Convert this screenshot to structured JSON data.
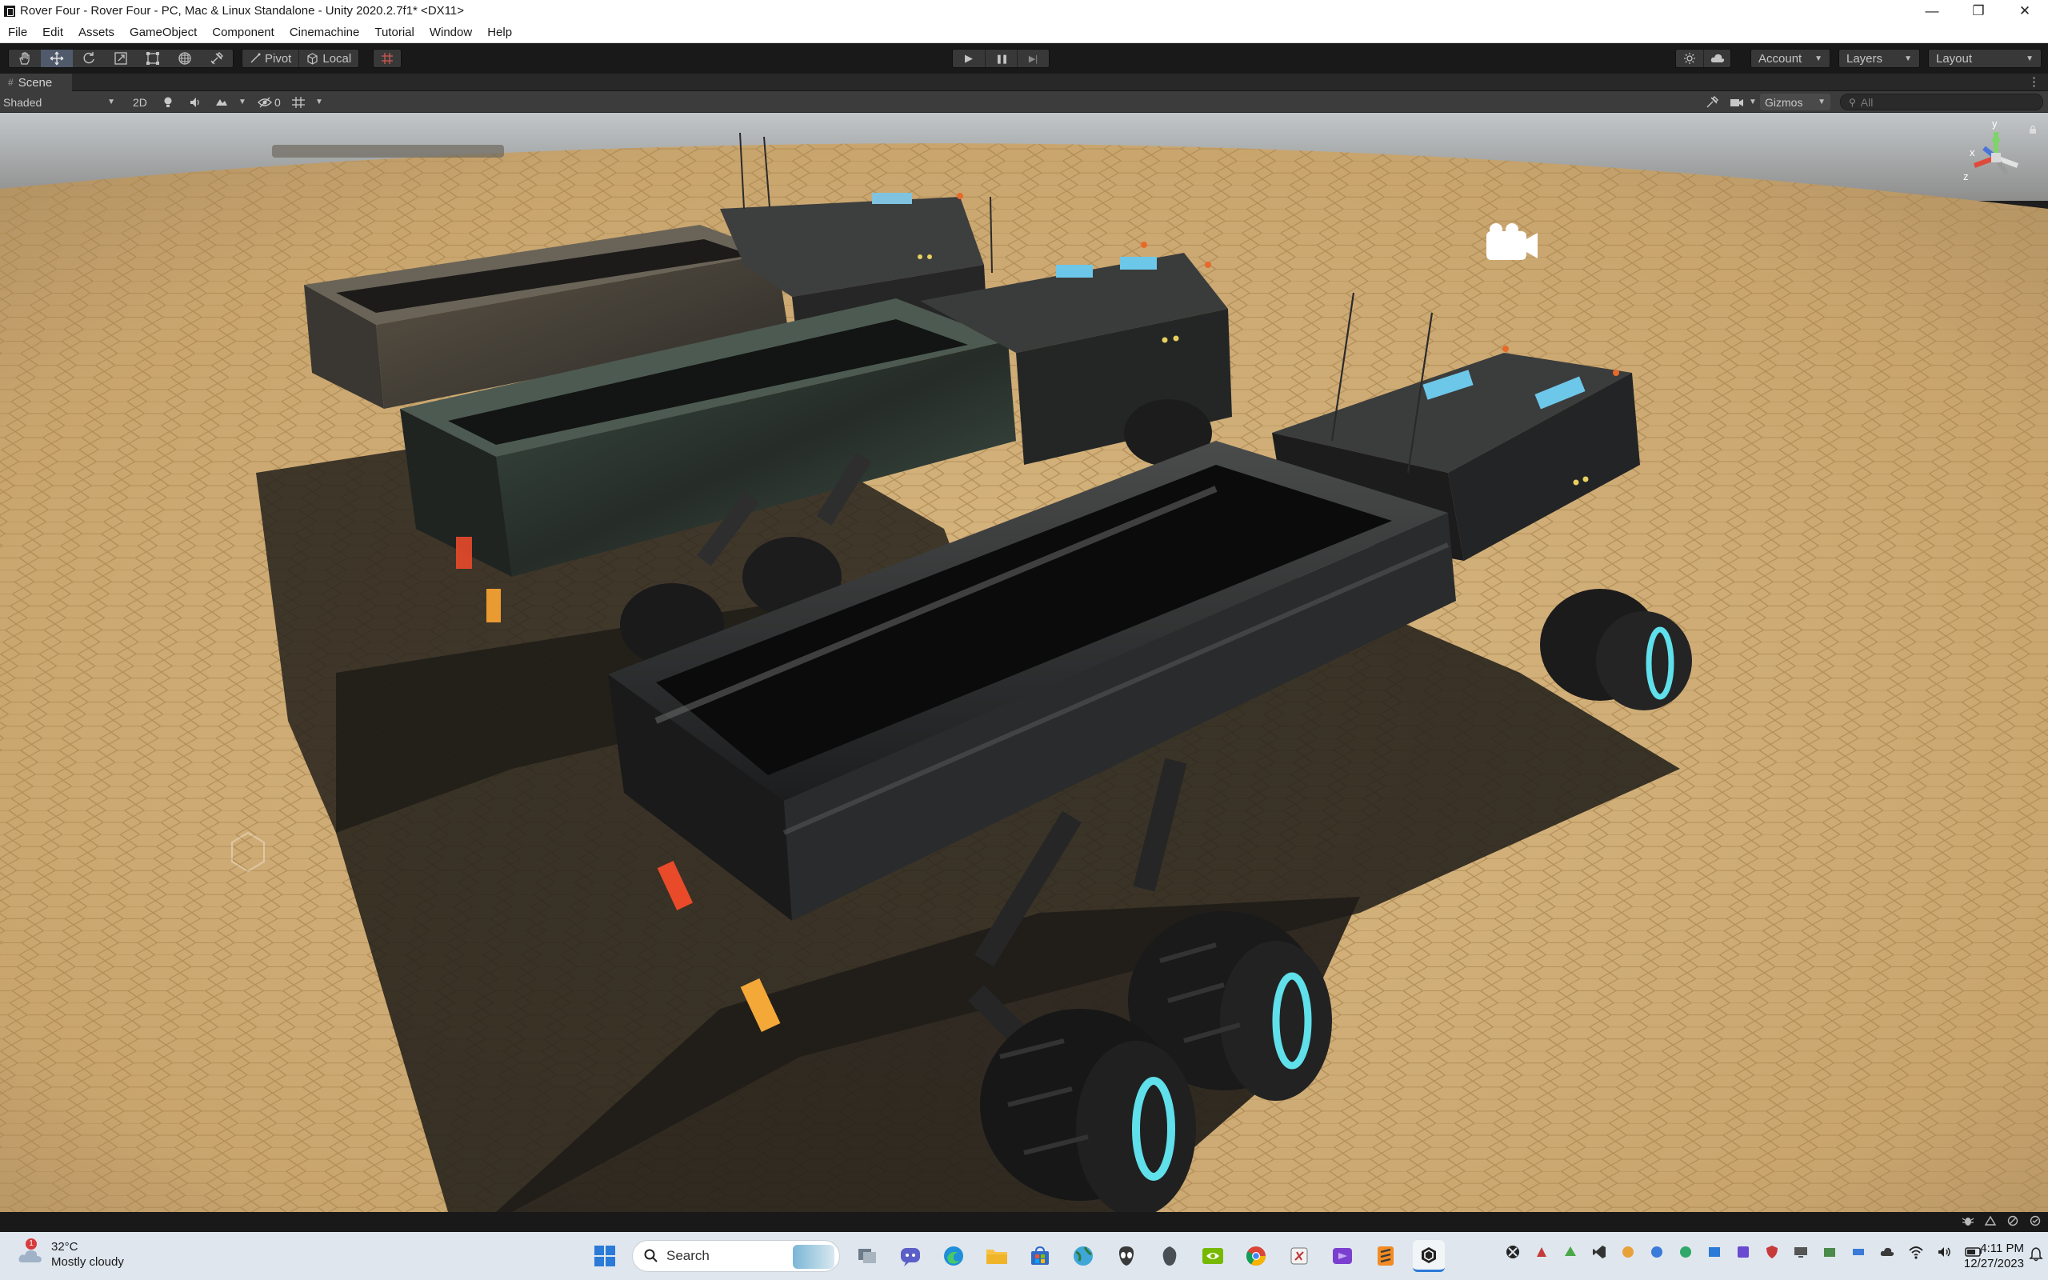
{
  "window": {
    "title": "Rover Four - Rover Four - PC, Mac & Linux Standalone - Unity 2020.2.7f1* <DX11>",
    "minimize": "—",
    "maximize": "❐",
    "close": "✕"
  },
  "menubar": [
    "File",
    "Edit",
    "Assets",
    "GameObject",
    "Component",
    "Cinemachine",
    "Tutorial",
    "Window",
    "Help"
  ],
  "toolbar": {
    "tools": [
      "hand-tool",
      "move-tool",
      "rotate-tool",
      "scale-tool",
      "rect-tool",
      "transform-tool",
      "custom-tool"
    ],
    "active_tool": "move-tool",
    "pivot_label": "Pivot",
    "local_label": "Local",
    "play_icon": "▶",
    "pause_icon": "❚❚",
    "step_icon": "▶|",
    "account_label": "Account",
    "layers_label": "Layers",
    "layout_label": "Layout"
  },
  "scene_tab": {
    "label": "Scene",
    "icon": "#",
    "more": "⋮"
  },
  "scene_toolbar": {
    "draw_mode": "Shaded",
    "mode_2d": "2D",
    "hidden_count": "0",
    "gizmos_label": "Gizmos",
    "search_placeholder": "All"
  },
  "gizmo_axes": {
    "x": "x",
    "y": "y",
    "z": "z"
  },
  "taskbar": {
    "weather_temp": "32°C",
    "weather_desc": "Mostly cloudy",
    "weather_badge": "1",
    "search_label": "Search",
    "time": "4:11 PM",
    "date": "12/27/2023"
  },
  "colors": {
    "ground": "#c9a56e",
    "hex_lines": "#b08c57",
    "editor_dark": "#191919",
    "accent_active": "#505a6b",
    "wheel_glow": "#5fe0ea"
  }
}
